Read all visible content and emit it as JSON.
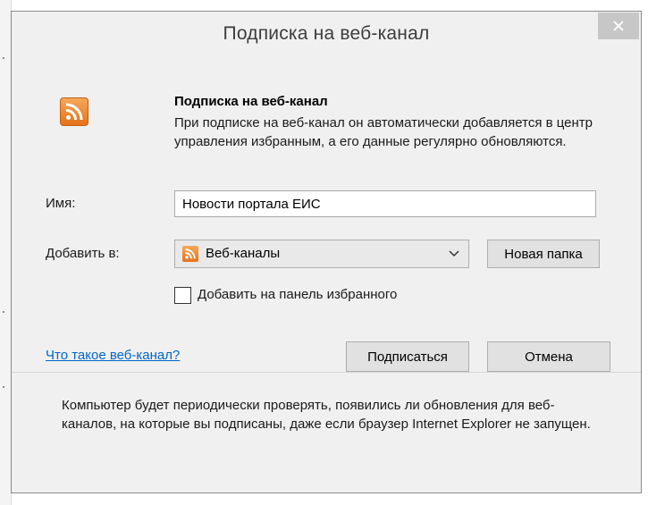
{
  "window": {
    "title": "Подписка на веб-канал"
  },
  "header": {
    "heading": "Подписка на веб-канал",
    "description": "При подписке на веб-канал он автоматически добавляется в центр управления избранным, а его данные регулярно обновляются.",
    "icon": "rss-feed-icon"
  },
  "form": {
    "name_label": "Имя:",
    "name_value": "Новости портала ЕИС",
    "add_to_label": "Добавить в:",
    "add_to_selected": "Веб-каналы",
    "new_folder_label": "Новая папка",
    "favorites_bar_checkbox_label": "Добавить на панель избранного",
    "favorites_bar_checked": false
  },
  "actions": {
    "help_link": "Что такое веб-канал?",
    "subscribe_label": "Подписаться",
    "cancel_label": "Отмена"
  },
  "footer": {
    "note": "Компьютер будет периодически проверять, появились ли обновления для веб-каналов, на которые вы подписаны, даже если браузер Internet Explorer не запущен."
  },
  "colors": {
    "accent_link": "#0066cc",
    "rss_orange": "#e4721a",
    "close_button": "#c7c7c7"
  }
}
